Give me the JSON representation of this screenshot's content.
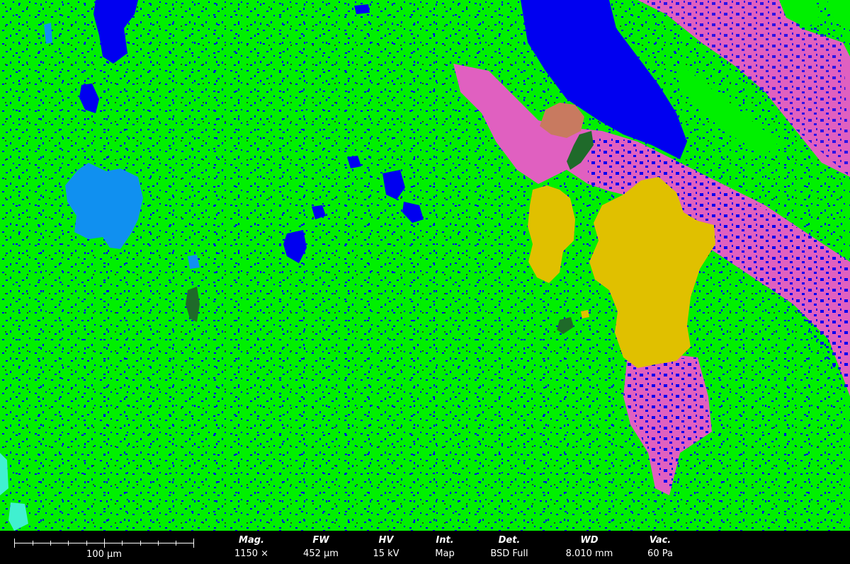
{
  "image": {
    "description_colors": {
      "matrix": "#00f000",
      "pore": "#0000f0",
      "phase_pink": "#e060c0",
      "phase_yellow": "#e0c000",
      "phase_lightblue": "#1090f0",
      "phase_darkgreen": "#1f6a2a",
      "phase_brown": "#c87a60",
      "phase_cyan": "#40f0d0"
    }
  },
  "databar": {
    "scale_label": "100 µm",
    "fields": [
      {
        "label": "Mag.",
        "value": "1150 ×"
      },
      {
        "label": "FW",
        "value": "452 µm"
      },
      {
        "label": "HV",
        "value": "15 kV"
      },
      {
        "label": "Int.",
        "value": "Map"
      },
      {
        "label": "Det.",
        "value": "BSD Full"
      },
      {
        "label": "WD",
        "value": "8.010 mm"
      },
      {
        "label": "Vac.",
        "value": "60 Pa"
      }
    ]
  }
}
